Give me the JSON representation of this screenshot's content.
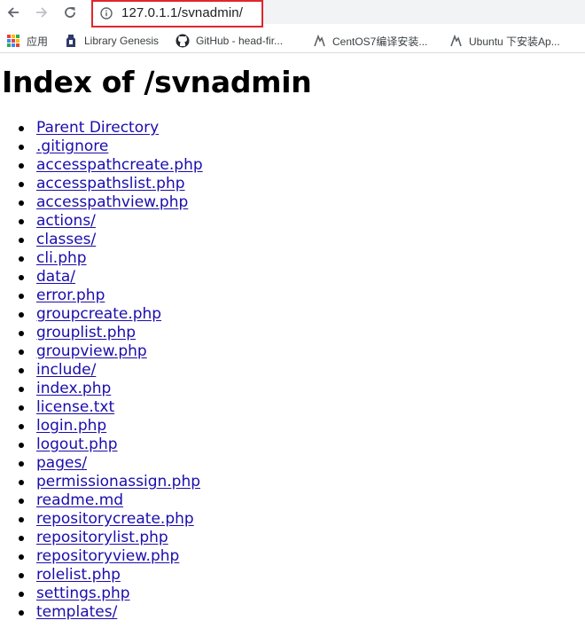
{
  "browser": {
    "url": "127.0.1.1/svnadmin/",
    "icons": {
      "back": "back-arrow-icon",
      "forward": "forward-arrow-icon",
      "reload": "reload-icon",
      "info": "info-icon"
    },
    "highlight_color": "#e0262b"
  },
  "bookmarks": [
    {
      "label": "应用",
      "icon": "apps-grid-icon"
    },
    {
      "label": "Library Genesis",
      "icon": "libgen-icon"
    },
    {
      "label": "GitHub - head-fir...",
      "icon": "github-icon"
    },
    {
      "label": "CentOS7编译安装...",
      "icon": "site-icon"
    },
    {
      "label": "Ubuntu 下安装Ap...",
      "icon": "site-icon"
    }
  ],
  "page": {
    "title": "Index of /svnadmin",
    "link_color": "#1a0dab",
    "entries": [
      "Parent Directory",
      ".gitignore",
      "accesspathcreate.php",
      "accesspathslist.php",
      "accesspathview.php",
      "actions/",
      "classes/",
      "cli.php",
      "data/",
      "error.php",
      "groupcreate.php",
      "grouplist.php",
      "groupview.php",
      "include/",
      "index.php",
      "license.txt",
      "login.php",
      "logout.php",
      "pages/",
      "permissionassign.php",
      "readme.md",
      "repositorycreate.php",
      "repositorylist.php",
      "repositoryview.php",
      "rolelist.php",
      "settings.php",
      "templates/"
    ]
  }
}
